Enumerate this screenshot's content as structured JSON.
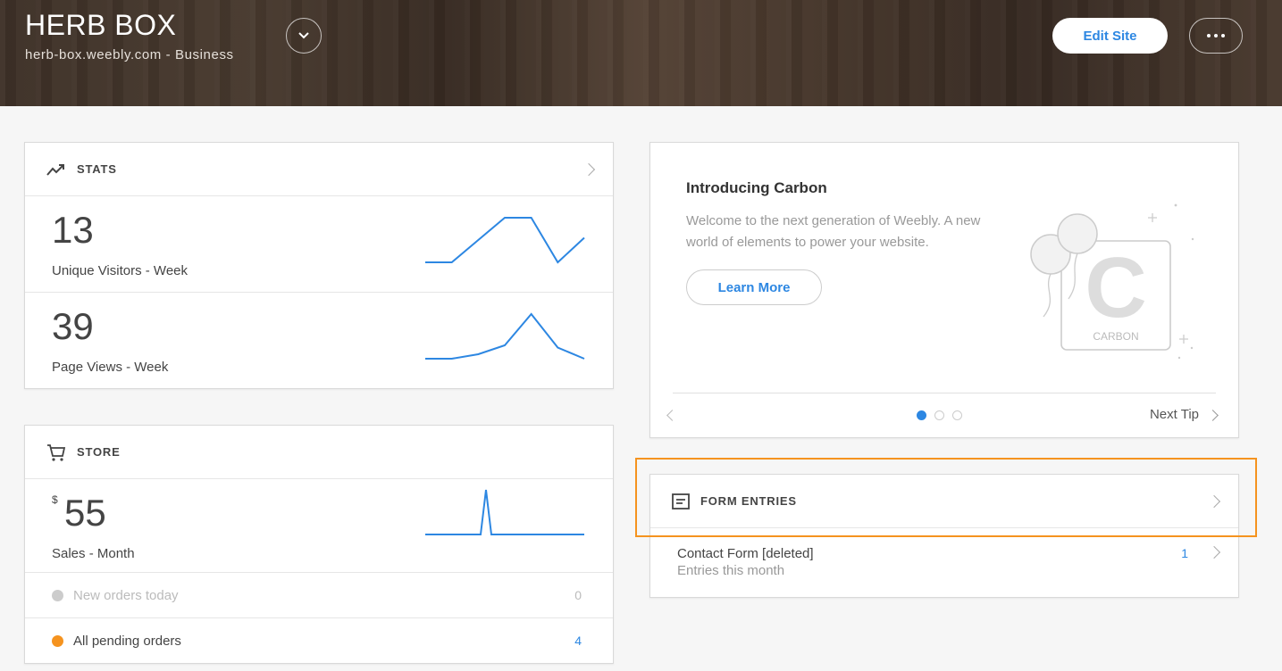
{
  "header": {
    "site_title": "HERB BOX",
    "site_subtitle": "herb-box.weebly.com - Business",
    "edit_label": "Edit Site"
  },
  "stats": {
    "title": "STATS",
    "rows": [
      {
        "value": "13",
        "label": "Unique Visitors - Week",
        "trend": [
          0,
          0,
          0.5,
          1,
          1,
          0,
          0.55
        ]
      },
      {
        "value": "39",
        "label": "Page Views - Week",
        "trend": [
          0,
          0,
          0.1,
          0.3,
          1,
          0.25,
          0
        ]
      }
    ]
  },
  "store": {
    "title": "STORE",
    "currency": "$",
    "sales_value": "55",
    "sales_label": "Sales - Month",
    "sales_trend": [
      0,
      0,
      0,
      1,
      0,
      0,
      0,
      0
    ],
    "orders": [
      {
        "label": "New orders today",
        "count": "0",
        "dot_color": "#cccccc"
      },
      {
        "label": "All pending orders",
        "count": "4",
        "dot_color": "#f5931f"
      }
    ]
  },
  "tip": {
    "title": "Introducing Carbon",
    "text": "Welcome to the next generation of Weebly. A new world of elements to power your website.",
    "button": "Learn More",
    "illustration_label": "CARBON",
    "next_label": "Next Tip",
    "page_count": 3,
    "active_page": 0
  },
  "forms": {
    "title": "FORM ENTRIES",
    "entries": [
      {
        "name": "Contact Form [deleted]",
        "sub": "Entries this month",
        "count": "1"
      }
    ]
  },
  "colors": {
    "accent": "#2d87e2",
    "highlight": "#f5931f"
  }
}
